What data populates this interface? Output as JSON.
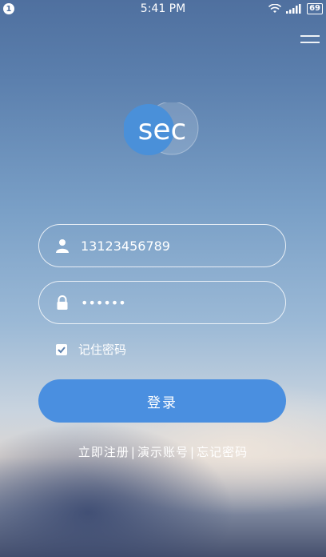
{
  "status_bar": {
    "notification_count": "1",
    "time": "5:41 PM",
    "battery": "69",
    "icons": [
      "wifi-icon",
      "signal-icon",
      "battery-icon"
    ]
  },
  "header": {
    "menu_icon": "menu-icon"
  },
  "logo": {
    "text": "sec"
  },
  "form": {
    "phone_value": "13123456789",
    "password_value": "••••••",
    "remember_label": "记住密码",
    "remember_checked": true,
    "login_label": "登录"
  },
  "links": {
    "register": "立即注册",
    "demo_account": "演示账号",
    "forgot_password": "忘记密码",
    "separator": "|"
  },
  "colors": {
    "button": "#4a8fe0",
    "logo_circle": "#4a90d9"
  }
}
